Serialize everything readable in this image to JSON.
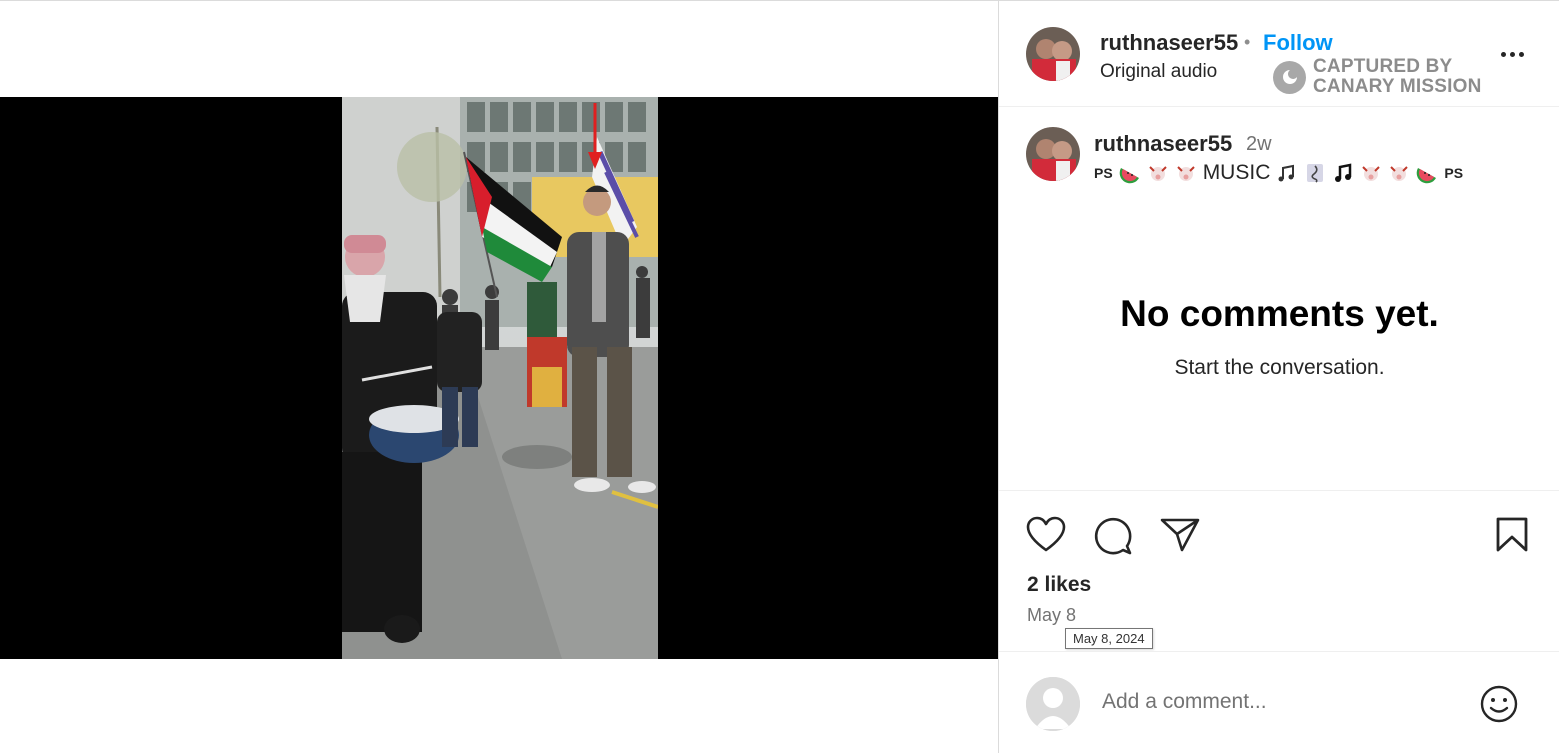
{
  "post": {
    "username": "ruthnaseer55",
    "follow_label": "Follow",
    "separator": "•",
    "audio_label": "Original audio",
    "watermark_line1": "CAPTURED BY",
    "watermark_line2": "CANARY MISSION"
  },
  "caption": {
    "username": "ruthnaseer55",
    "time_ago": "2w",
    "ps_left": "PS",
    "music_word": "MUSIC",
    "ps_right": "PS"
  },
  "comments": {
    "empty_title": "No comments yet.",
    "empty_subtitle": "Start the conversation."
  },
  "engagement": {
    "likes": "2 likes",
    "date": "May 8",
    "date_tooltip": "May 8, 2024"
  },
  "comment_box": {
    "placeholder": "Add a comment..."
  },
  "colors": {
    "accent": "#0095f6",
    "text": "#262626",
    "muted": "#737373"
  },
  "icons": [
    "heart-icon",
    "comment-icon",
    "share-icon",
    "bookmark-icon",
    "emoji-icon",
    "mute-icon",
    "more-icon"
  ]
}
